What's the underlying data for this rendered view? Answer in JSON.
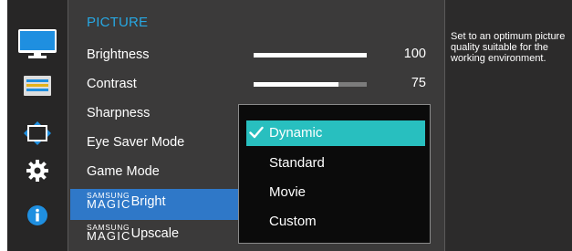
{
  "menu": {
    "title": "PICTURE",
    "items": [
      {
        "label": "Brightness",
        "value": "100",
        "level": 100
      },
      {
        "label": "Contrast",
        "value": "75",
        "level": 75
      },
      {
        "label": "Sharpness"
      },
      {
        "label": "Eye Saver Mode"
      },
      {
        "label": "Game Mode"
      },
      {
        "brand_top": "SAMSUNG",
        "brand_mid": "MAGIC",
        "label": "Bright"
      },
      {
        "brand_top": "SAMSUNG",
        "brand_mid": "MAGIC",
        "label": "Upscale"
      }
    ]
  },
  "dropdown": {
    "options": [
      "Dynamic",
      "Standard",
      "Movie",
      "Custom"
    ],
    "selected": "Dynamic"
  },
  "help_text": "Set to an optimum picture quality suitable for the working environment.",
  "sidebar_icons": [
    "picture-icon",
    "onscreen-display-icon",
    "position-icon",
    "gear-icon",
    "info-icon"
  ],
  "colors": {
    "title": "#27a7e2",
    "row_highlight": "#2f78c8",
    "option_highlight": "#28bfbf",
    "info": "#1f8fe0"
  }
}
